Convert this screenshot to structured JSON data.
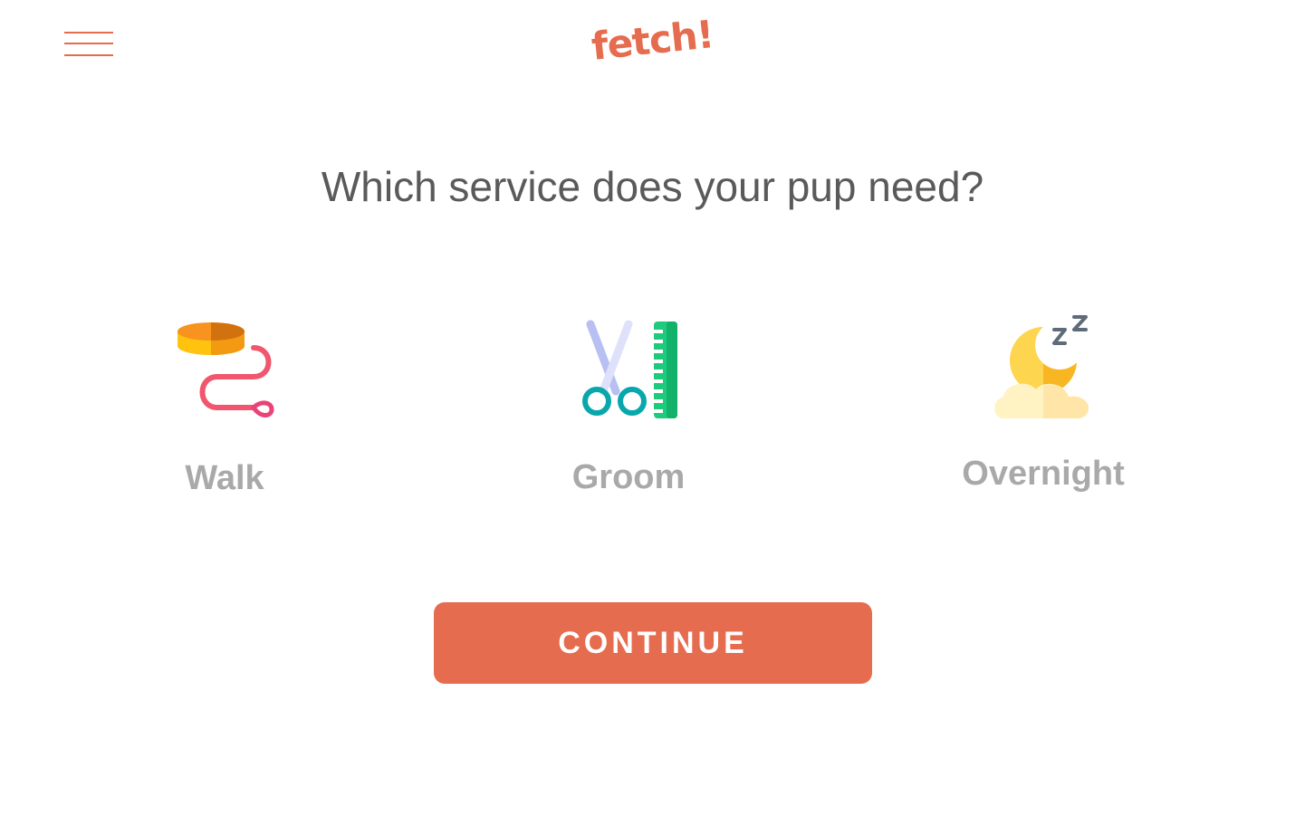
{
  "header": {
    "logo_text": "fetch!",
    "menu_icon": "hamburger-menu-icon"
  },
  "prompt": {
    "question": "Which service does your pup need?"
  },
  "services": [
    {
      "label": "Walk",
      "icon": "leash-collar-icon"
    },
    {
      "label": "Groom",
      "icon": "scissors-comb-icon"
    },
    {
      "label": "Overnight",
      "icon": "moon-sleep-icon"
    }
  ],
  "actions": {
    "continue_label": "CONTINUE"
  },
  "colors": {
    "accent": "#e56c4e",
    "question_text": "#5a5a5a",
    "service_label": "#a9a9a9",
    "background": "#ffffff"
  }
}
